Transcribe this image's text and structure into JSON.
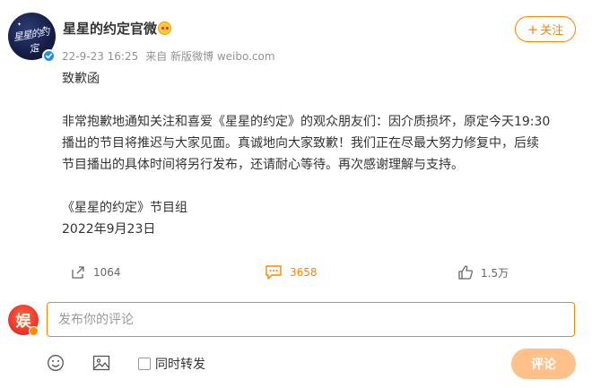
{
  "author": {
    "name": "星星的约定官微",
    "avatar_text": "星星的约定",
    "verified": true
  },
  "meta": {
    "time": "22-9-23 16:25",
    "source": "来自 新版微博 weibo.com"
  },
  "follow_button": {
    "label": "关注"
  },
  "post": {
    "title": "致歉函",
    "lines": [
      "非常抱歉地通知关注和喜爱《星星的约定》的观众朋友们：因介质损坏，原定今天19:30",
      "播出的节目将推迟与大家见面。真诚地向大家致歉！我们正在尽最大努力修复中，后续",
      "节目播出的具体时间将另行发布，还请耐心等待。再次感谢理解与支持。"
    ],
    "signature": "《星星的约定》节目组",
    "date": "2022年9月23日"
  },
  "actions": {
    "reposts": "1064",
    "comments": "3658",
    "likes": "1.5万"
  },
  "comment_box": {
    "placeholder": "发布你的评论",
    "my_avatar_text": "娱",
    "repost_label": "同时转发",
    "submit_label": "评论"
  },
  "colors": {
    "accent": "#ff8200",
    "submit_disabled": "#ffc08a",
    "meta_text": "#939393",
    "verified_blue": "#1d8ef5"
  },
  "icons": [
    "check-icon",
    "badge-icon",
    "plus-icon",
    "repost-icon",
    "comment-icon",
    "like-icon",
    "emoji-icon",
    "image-icon"
  ]
}
